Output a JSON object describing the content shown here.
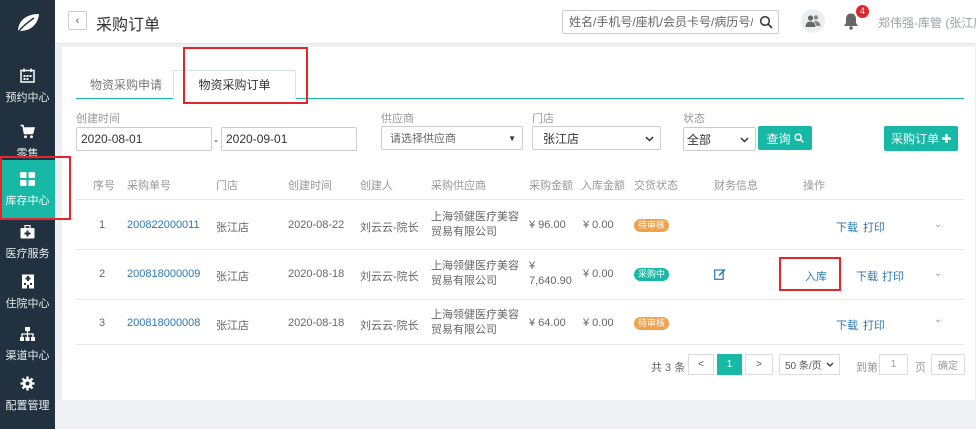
{
  "sidebar": {
    "items": [
      {
        "label": "预约中心",
        "icon": "calendar-icon"
      },
      {
        "label": "零售",
        "icon": "cart-icon"
      },
      {
        "label": "库存中心",
        "icon": "grid-icon"
      },
      {
        "label": "医疗服务",
        "icon": "medical-kit-icon"
      },
      {
        "label": "住院中心",
        "icon": "hospital-icon"
      },
      {
        "label": "渠道中心",
        "icon": "hierarchy-icon"
      },
      {
        "label": "配置管理",
        "icon": "gear-icon"
      }
    ],
    "active_color": "#17b8a6"
  },
  "header": {
    "back_glyph": "‹",
    "title": "采购订单",
    "search_placeholder": "姓名/手机号/座机/会员卡号/病历号/微信号",
    "notification_count": "4",
    "user": "郑伟强-库管 (张江店)"
  },
  "tabs": [
    {
      "label": "物资采购申请"
    },
    {
      "label": "物资采购订单"
    }
  ],
  "filters": {
    "created_label": "创建时间",
    "date_from": "2020-08-01",
    "date_sep": "-",
    "date_to": "2020-09-01",
    "supplier_label": "供应商",
    "supplier_value": "请选择供应商",
    "store_label": "门店",
    "store_value": "张江店",
    "status_label": "状态",
    "status_value": "全部",
    "query_button": "查询",
    "order_button": "采购订单"
  },
  "table": {
    "headers": [
      "序号",
      "采购单号",
      "门店",
      "创建时间",
      "创建人",
      "采购供应商",
      "采购金额",
      "入库金额",
      "交货状态",
      "财务信息",
      "操作"
    ],
    "rows": [
      {
        "index": "1",
        "order_no": "200822000011",
        "store": "张江店",
        "created": "2020-08-22",
        "creator": "刘云云-院长",
        "supplier": "上海领健医疗美容贸易有限公司",
        "amount": "¥ 96.00",
        "stock_amount": "¥ 0.00",
        "status": "待审核",
        "actions": [
          "下载",
          "打印"
        ]
      },
      {
        "index": "2",
        "order_no": "200818000009",
        "store": "张江店",
        "created": "2020-08-18",
        "creator": "刘云云-院长",
        "supplier": "上海领健医疗美容贸易有限公司",
        "amount": "¥ 7,640.90",
        "stock_amount": "¥ 0.00",
        "status": "采购中",
        "actions": [
          "入库",
          "下载",
          "打印"
        ]
      },
      {
        "index": "3",
        "order_no": "200818000008",
        "store": "张江店",
        "created": "2020-08-18",
        "creator": "刘云云-院长",
        "supplier": "上海领健医疗美容贸易有限公司",
        "amount": "¥ 64.00",
        "stock_amount": "¥ 0.00",
        "status": "待审核",
        "actions": [
          "下载",
          "打印"
        ]
      }
    ]
  },
  "pagination": {
    "total": "共 3 条",
    "prev": "<",
    "current": "1",
    "next": ">",
    "page_size": "50 条/页",
    "goto_label": "到第",
    "goto_value": "1",
    "page_unit": "页",
    "confirm": "确定"
  },
  "colors": {
    "accent": "#17b8a6",
    "link": "#2a78b4",
    "pending": "#f0a24b",
    "highlight_box": "#e3262b"
  }
}
